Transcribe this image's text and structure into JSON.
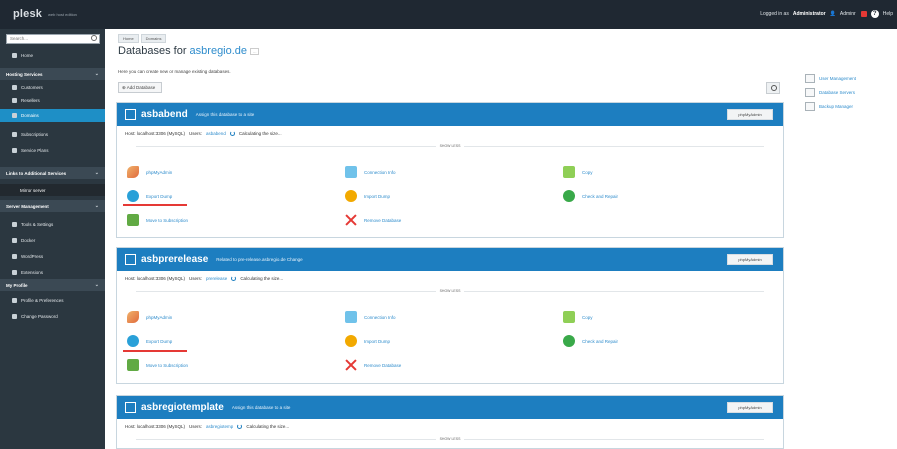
{
  "app": {
    "logo": "plesk",
    "edition": "web host edition"
  },
  "topbar": {
    "logged_prefix": "Logged in as",
    "user": "Administrator",
    "account": "Adminr",
    "help": "Help"
  },
  "sidebar": {
    "search_placeholder": "Search...",
    "items": [
      {
        "label": "Home"
      },
      {
        "section": "Hosting Services"
      },
      {
        "label": "Customers"
      },
      {
        "label": "Resellers"
      },
      {
        "label": "Domains",
        "active": true
      },
      {
        "label": "Subscriptions"
      },
      {
        "label": "Service Plans"
      },
      {
        "section": "Links to Additional Services"
      },
      {
        "label": "Mirror server",
        "sub": true
      },
      {
        "section": "Server Management"
      },
      {
        "label": "Tools & Settings"
      },
      {
        "label": "Docker"
      },
      {
        "label": "WordPress"
      },
      {
        "label": "Extensions"
      },
      {
        "section": "My Profile"
      },
      {
        "label": "Profile & Preferences"
      },
      {
        "label": "Change Password"
      }
    ]
  },
  "page": {
    "breadcrumb": [
      "Home",
      "Domains"
    ],
    "title_prefix": "Databases for",
    "title_domain": "asbregio.de",
    "title_tag": "...",
    "intro": "Here you can create new or manage existing databases.",
    "add_database": "Add Database"
  },
  "right_links": [
    "User Management",
    "Database Servers",
    "Backup Manager"
  ],
  "databases": [
    {
      "name": "asbabend",
      "note": "Assign this database to a site",
      "phpmyadmin": "phpMyAdmin",
      "host": "Host: localhost:3306 (MySQL)",
      "users_label": "Users:",
      "users": "asbabend",
      "size": "Calculating the size...",
      "less": "SHOW LESS"
    },
    {
      "name": "asbprerelease",
      "note": "Related to pre-release.asbregio.de Change",
      "phpmyadmin": "phpMyAdmin",
      "host": "Host: localhost:3306 (MySQL)",
      "users_label": "Users:",
      "users": "prerelease",
      "size": "Calculating the size...",
      "less": "SHOW LESS"
    },
    {
      "name": "asbregiotemplate",
      "note": "Assign this database to a site",
      "phpmyadmin": "phpMyAdmin",
      "host": "Host: localhost:3306 (MySQL)",
      "users_label": "Users:",
      "users": "asbregiotemp",
      "size": "Calculating the size...",
      "less": "SHOW LESS"
    }
  ],
  "actions": {
    "phpmyadmin": "phpMyAdmin",
    "connection_info": "Connection Info",
    "copy": "Copy",
    "export_dump": "Export Dump",
    "import_dump": "Import Dump",
    "check_repair": "Check and Repair",
    "move_subscription": "Move to Subscription",
    "remove_database": "Remove Database"
  },
  "colors": {
    "topbar": "#1f2832",
    "sidebar": "#2b3740",
    "accent": "#1d7ec0",
    "link": "#2e8ccc",
    "highlight": "#e53935"
  }
}
